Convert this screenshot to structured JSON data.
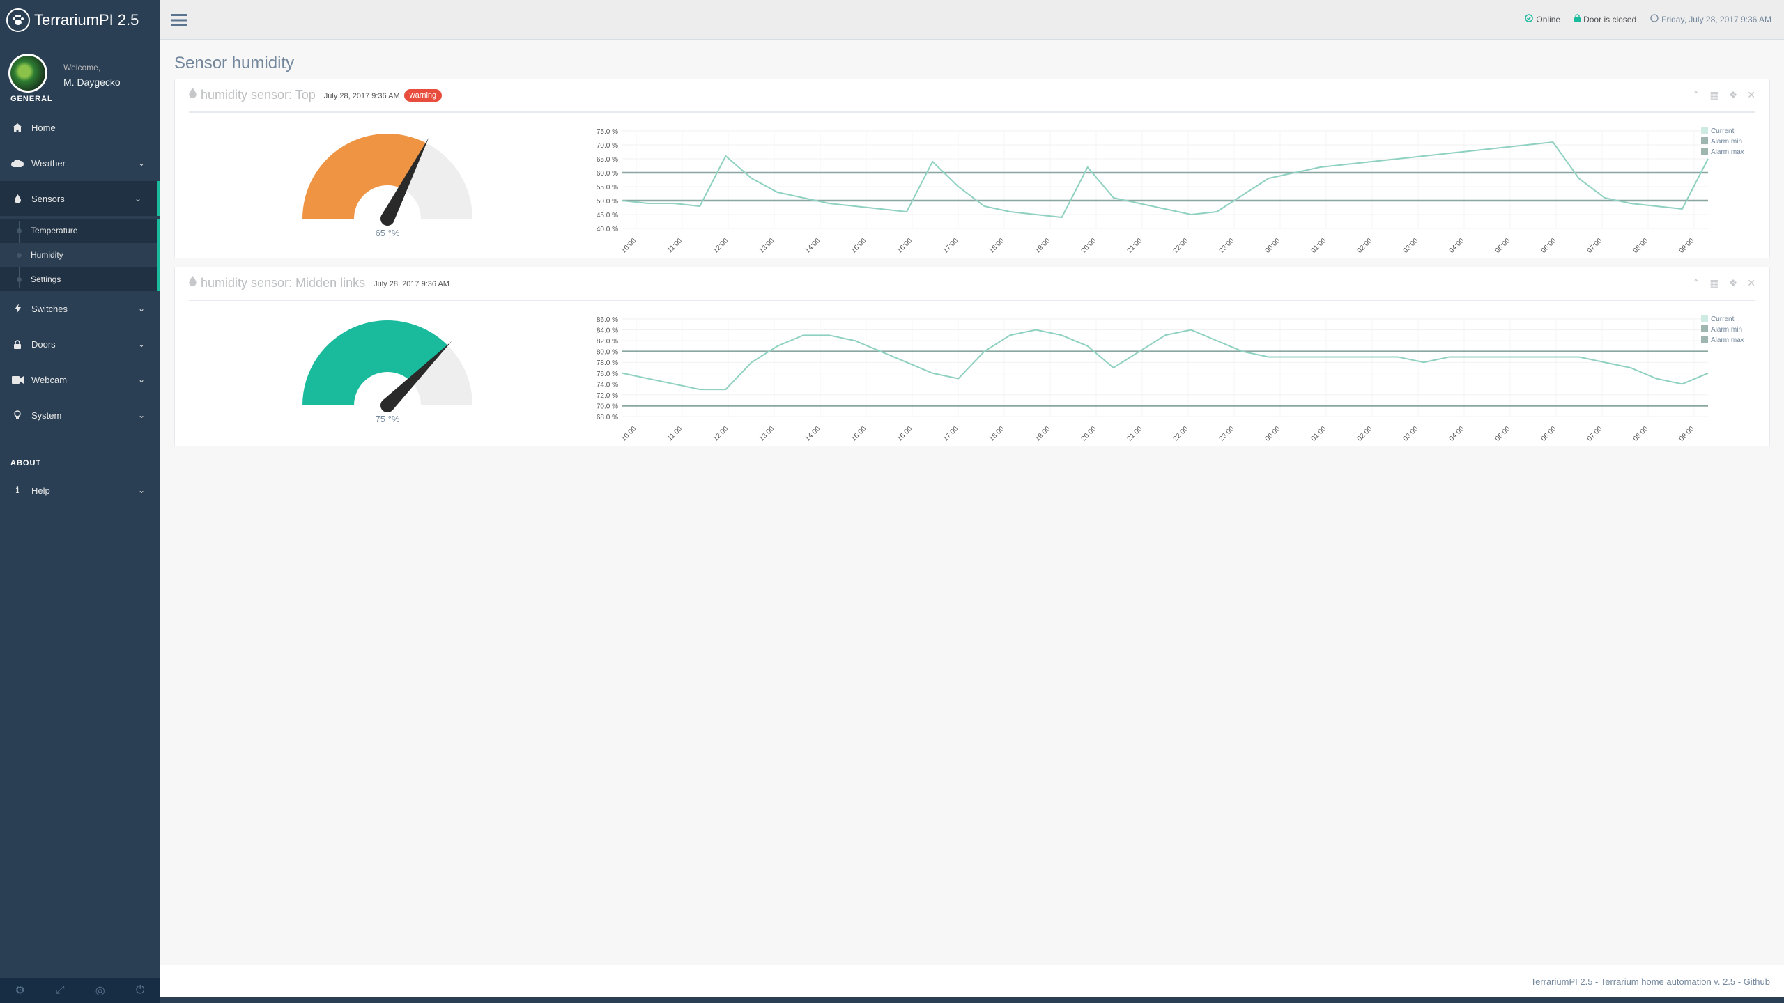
{
  "app": {
    "title": "TerrariumPI 2.5"
  },
  "profile": {
    "welcome": "Welcome,",
    "name": "M. Daygecko"
  },
  "sidebar": {
    "section_general": "GENERAL",
    "section_about": "ABOUT",
    "items": [
      {
        "label": "Home",
        "icon": "home-icon"
      },
      {
        "label": "Weather",
        "icon": "cloud-icon"
      },
      {
        "label": "Sensors",
        "icon": "tint-icon"
      },
      {
        "label": "Switches",
        "icon": "bolt-icon"
      },
      {
        "label": "Doors",
        "icon": "lock-icon"
      },
      {
        "label": "Webcam",
        "icon": "video-icon"
      },
      {
        "label": "System",
        "icon": "lightbulb-icon"
      },
      {
        "label": "Help",
        "icon": "info-icon"
      }
    ],
    "sensor_subitems": [
      "Temperature",
      "Humidity",
      "Settings"
    ]
  },
  "topbar": {
    "status_online": "Online",
    "door_status": "Door is closed",
    "datetime": "Friday, July 28, 2017 9:36 AM"
  },
  "page": {
    "title": "Sensor humidity"
  },
  "panels": [
    {
      "title": "humidity sensor: Top",
      "date": "July 28, 2017 9:36 AM",
      "badge": "warning",
      "gauge_value": 65,
      "gauge_label": "65 °%",
      "gauge_color": "#EE9443"
    },
    {
      "title": "humidity sensor: Midden links",
      "date": "July 28, 2017 9:36 AM",
      "badge": "",
      "gauge_value": 75,
      "gauge_label": "75 °%",
      "gauge_color": "#1ABB9C"
    }
  ],
  "chart_data": [
    {
      "type": "line",
      "title": "",
      "x": [
        "10:00",
        "11:00",
        "12:00",
        "13:00",
        "14:00",
        "15:00",
        "16:00",
        "17:00",
        "18:00",
        "19:00",
        "20:00",
        "21:00",
        "22:00",
        "23:00",
        "00:00",
        "01:00",
        "02:00",
        "03:00",
        "04:00",
        "05:00",
        "06:00",
        "07:00",
        "08:00",
        "09:00"
      ],
      "yticks": [
        "75.0 %",
        "70.0 %",
        "65.0 %",
        "60.0 %",
        "55.0 %",
        "50.0 %",
        "45.0 %",
        "40.0 %"
      ],
      "ylim": [
        40,
        75
      ],
      "legend": [
        "Current",
        "Alarm min",
        "Alarm max"
      ],
      "legend_position": "top-right",
      "alarm_min": 50,
      "alarm_max": 60,
      "series": [
        {
          "name": "Current",
          "values": [
            50,
            49,
            49,
            48,
            66,
            58,
            53,
            51,
            49,
            48,
            47,
            46,
            64,
            55,
            48,
            46,
            45,
            44,
            62,
            51,
            49,
            47,
            45,
            46,
            52,
            58,
            60,
            62,
            63,
            64,
            65,
            66,
            67,
            68,
            69,
            70,
            71,
            58,
            51,
            49,
            48,
            47,
            65
          ]
        }
      ]
    },
    {
      "type": "line",
      "title": "",
      "x": [
        "10:00",
        "11:00",
        "12:00",
        "13:00",
        "14:00",
        "15:00",
        "16:00",
        "17:00",
        "18:00",
        "19:00",
        "20:00",
        "21:00",
        "22:00",
        "23:00",
        "00:00",
        "01:00",
        "02:00",
        "03:00",
        "04:00",
        "05:00",
        "06:00",
        "07:00",
        "08:00",
        "09:00"
      ],
      "yticks": [
        "86.0 %",
        "84.0 %",
        "82.0 %",
        "80.0 %",
        "78.0 %",
        "76.0 %",
        "74.0 %",
        "72.0 %",
        "70.0 %",
        "68.0 %"
      ],
      "ylim": [
        68,
        86
      ],
      "legend": [
        "Current",
        "Alarm min",
        "Alarm max"
      ],
      "legend_position": "top-right",
      "alarm_min": 70,
      "alarm_max": 80,
      "series": [
        {
          "name": "Current",
          "values": [
            76,
            75,
            74,
            73,
            73,
            78,
            81,
            83,
            83,
            82,
            80,
            78,
            76,
            75,
            80,
            83,
            84,
            83,
            81,
            77,
            80,
            83,
            84,
            82,
            80,
            79,
            79,
            79,
            79,
            79,
            79,
            78,
            79,
            79,
            79,
            79,
            79,
            79,
            78,
            77,
            75,
            74,
            76
          ]
        }
      ]
    }
  ],
  "footer": {
    "text": "TerrariumPI 2.5 - Terrarium home automation v. 2.5 - Github"
  },
  "colors": {
    "sidebar": "#2A3F54",
    "accent": "#1ABB9C",
    "line": "#8FD1C1",
    "alarm": "#8AA6A0",
    "danger": "#E74C3C"
  }
}
